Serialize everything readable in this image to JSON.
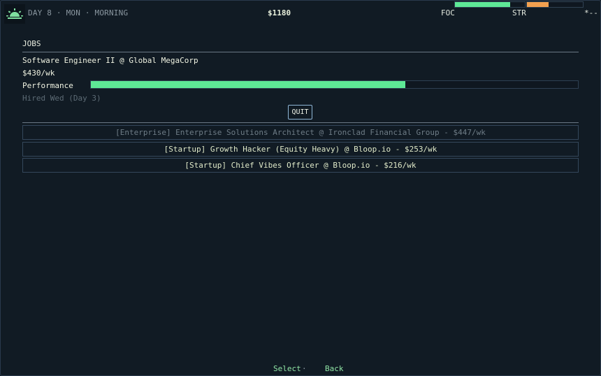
{
  "hud": {
    "day_label": "DAY 8 · MON · MORNING",
    "money": "$1180",
    "focus_label": "FOC",
    "focus_level": 0.79,
    "stress_label": "STR",
    "stress_level": 0.39,
    "extra_label": "*--",
    "icon": "sunrise-icon"
  },
  "jobs": {
    "section_title": "JOBS",
    "current": {
      "title": "Software Engineer II @ Global MegaCorp",
      "pay": "$430/wk",
      "performance_label": "Performance",
      "performance": 0.645,
      "hired": "Hired Wed (Day 3)",
      "quit_label": "QUIT"
    },
    "offers": [
      {
        "text": "[Enterprise] Enterprise Solutions Architect @ Ironclad Financial Group - $447/wk",
        "available": false
      },
      {
        "text": "[Startup] Growth Hacker (Equity Heavy) @ Bloop.io - $253/wk",
        "available": true
      },
      {
        "text": "[Startup] Chief Vibes Officer @ Bloop.io - $216/wk",
        "available": true
      }
    ]
  },
  "footer": {
    "select": "Select",
    "separator": "·",
    "back": "Back"
  },
  "colors": {
    "background": "#111b24",
    "accent_green": "#5ee896",
    "stress_orange": "#f3a04f",
    "border": "#34475b"
  }
}
